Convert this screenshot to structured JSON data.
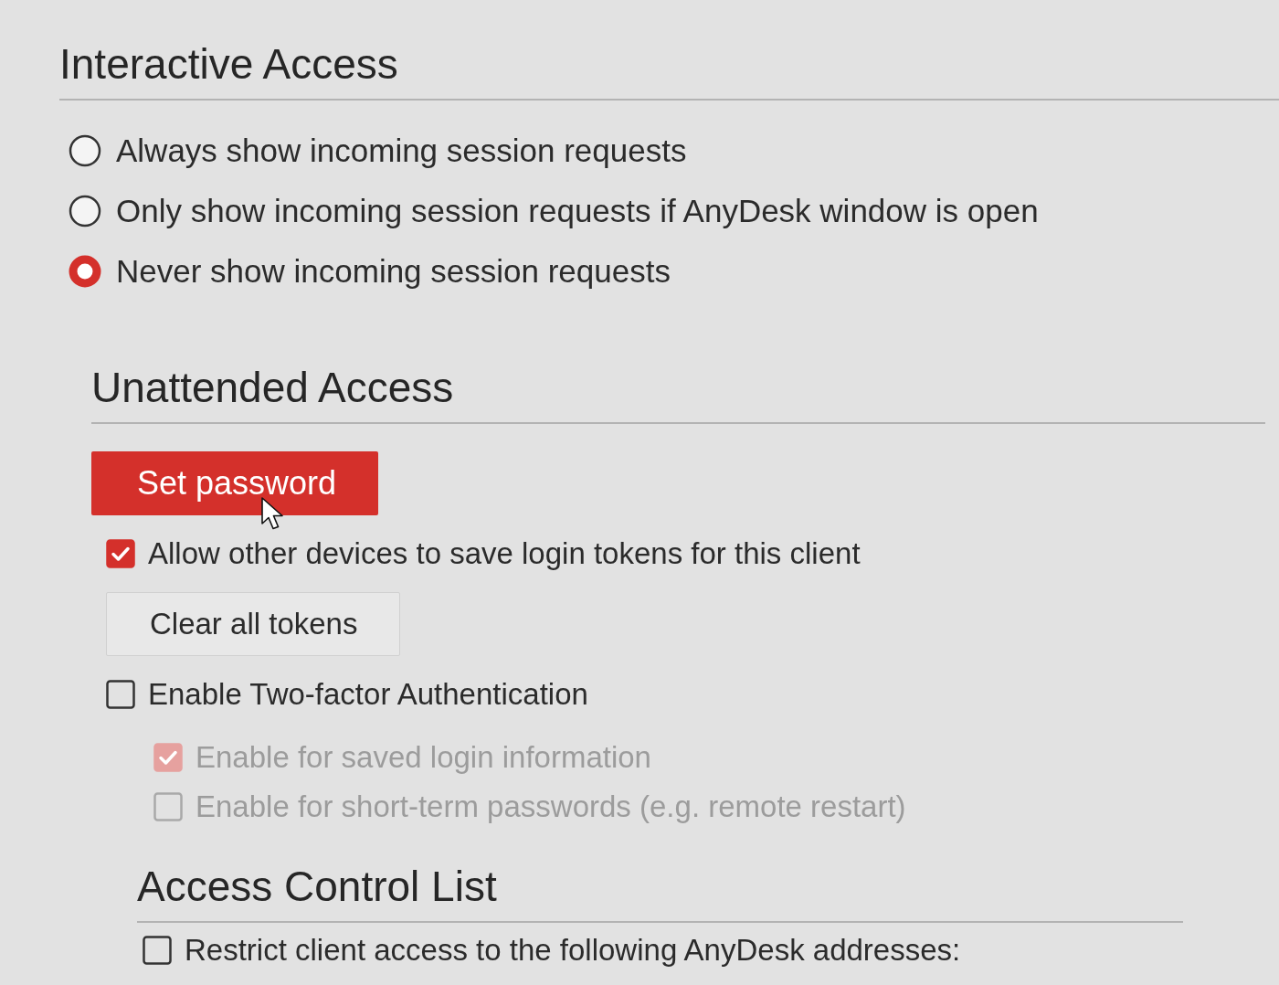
{
  "sections": [
    {
      "title": "Interactive Access",
      "items": [
        {
          "kind": "radio",
          "label": "Always show incoming session requests",
          "selected": false
        },
        {
          "kind": "radio",
          "label": "Only show incoming session requests if AnyDesk window is open",
          "selected": false
        },
        {
          "kind": "radio",
          "label": "Never show incoming session requests",
          "selected": true
        }
      ]
    },
    {
      "title": "Unattended Access",
      "items": [
        {
          "kind": "primary_button",
          "label": "Set password",
          "hovered": true
        },
        {
          "kind": "checkbox",
          "label": "Allow other devices to save login tokens for this client",
          "checked": true,
          "disabled": false
        },
        {
          "kind": "button",
          "label": "Clear all tokens"
        },
        {
          "kind": "checkbox",
          "label": "Enable Two-factor Authentication",
          "checked": false,
          "disabled": false,
          "children": [
            {
              "kind": "checkbox",
              "label": "Enable for saved login information",
              "checked": true,
              "disabled": true
            },
            {
              "kind": "checkbox",
              "label": "Enable for short-term passwords (e.g. remote restart)",
              "checked": false,
              "disabled": true
            }
          ]
        }
      ]
    },
    {
      "title": "Access Control List",
      "items": [
        {
          "kind": "checkbox",
          "label": "Restrict client access to the following AnyDesk addresses:",
          "checked": false,
          "disabled": false
        }
      ]
    }
  ]
}
